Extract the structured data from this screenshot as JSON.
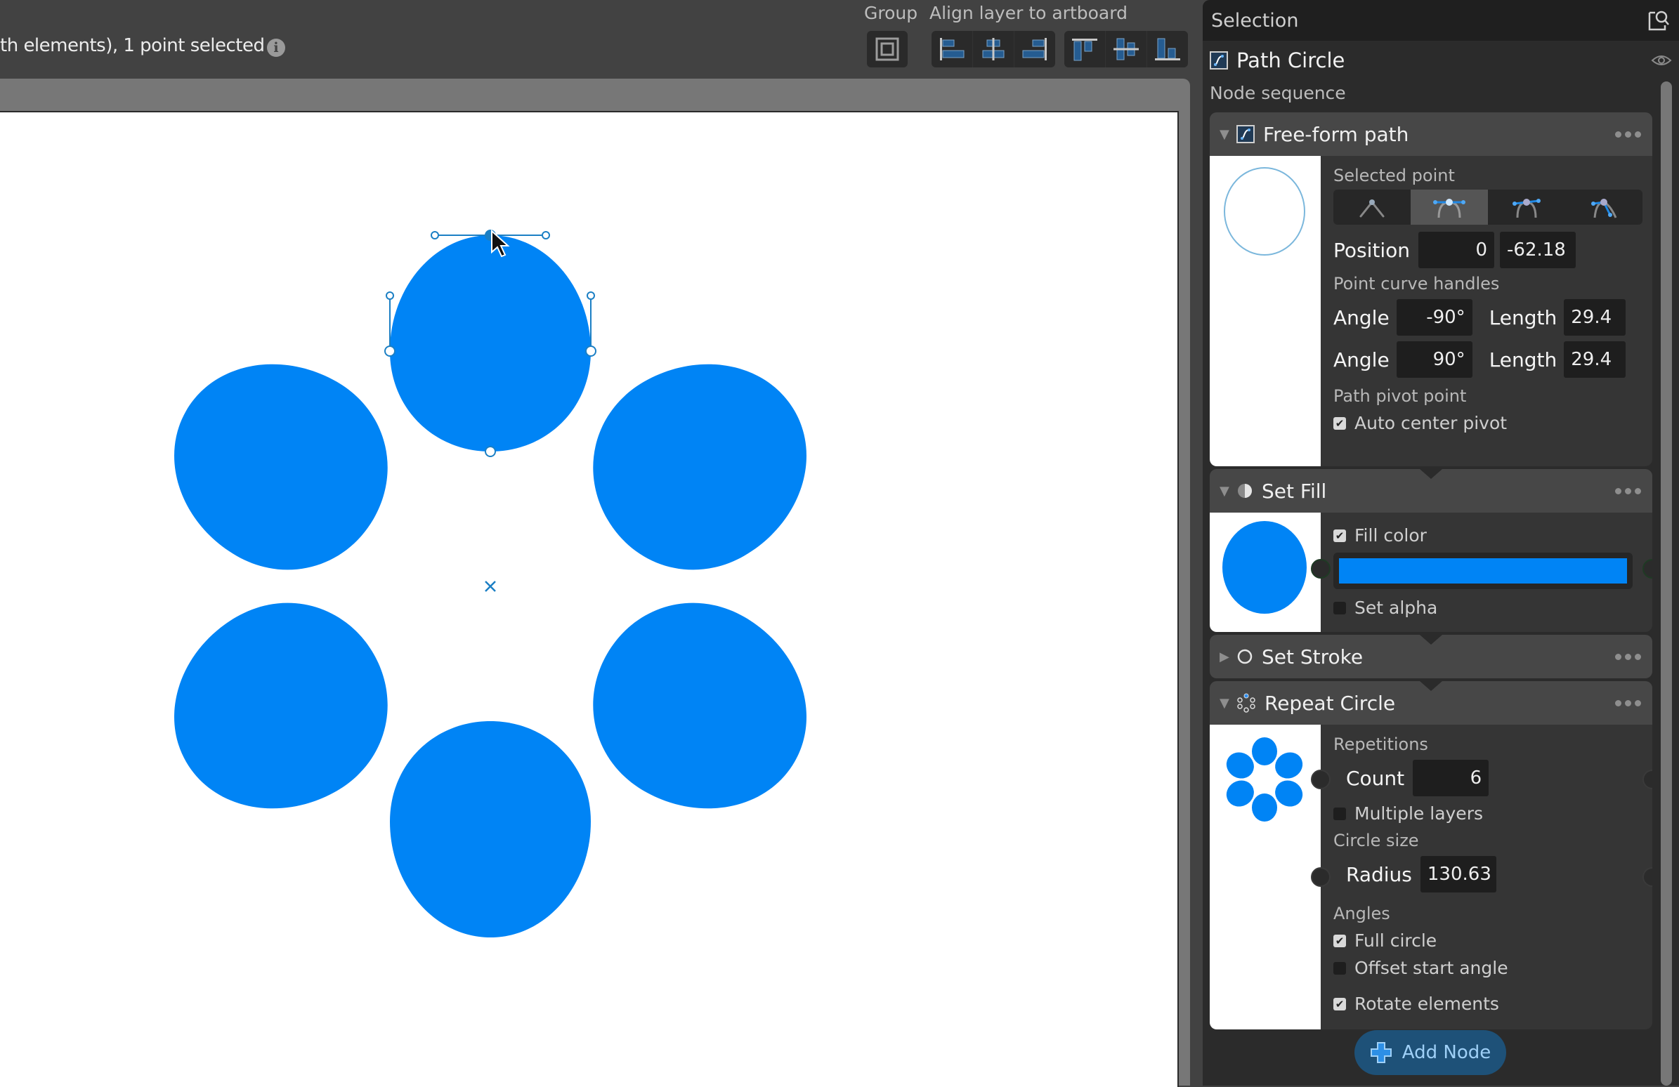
{
  "status": {
    "text": "th elements), 1 point selected",
    "info_icon": "info-icon"
  },
  "toolbar": {
    "group_label": "Group",
    "align_label": "Align layer to artboard",
    "group_button_icon": "group-frame-icon",
    "align_buttons": [
      {
        "name": "align-left",
        "icon": "align-left-icon"
      },
      {
        "name": "align-center-horizontal",
        "icon": "align-center-h-icon"
      },
      {
        "name": "align-right",
        "icon": "align-right-icon"
      },
      {
        "name": "align-top",
        "icon": "align-top-icon"
      },
      {
        "name": "align-center-vertical",
        "icon": "align-center-v-icon"
      },
      {
        "name": "align-bottom",
        "icon": "align-bottom-icon"
      }
    ]
  },
  "canvas": {
    "fill_color": "#0084f5",
    "repeat_count": 6,
    "selected_element": "top"
  },
  "panel": {
    "title": "Selection",
    "layer_name": "Path Circle",
    "node_sequence_label": "Node sequence",
    "nodes": {
      "freeform": {
        "title": "Free-form path",
        "selected_point_label": "Selected point",
        "point_types": [
          "corner",
          "smooth-symmetric",
          "smooth",
          "asymmetric"
        ],
        "active_point_type": 1,
        "position_label": "Position",
        "position_x": "0",
        "position_y": "-62.18",
        "handles_label": "Point curve handles",
        "angle_label": "Angle",
        "length_label": "Length",
        "handle1_angle": "-90°",
        "handle1_length": "29.4",
        "handle2_angle": "90°",
        "handle2_length": "29.4",
        "pivot_label": "Path pivot point",
        "auto_center_label": "Auto center pivot",
        "auto_center_checked": true
      },
      "fill": {
        "title": "Set Fill",
        "fill_color_label": "Fill color",
        "fill_color_checked": true,
        "color": "#0084f5",
        "set_alpha_label": "Set alpha",
        "set_alpha_checked": false
      },
      "stroke": {
        "title": "Set Stroke",
        "collapsed": true
      },
      "repeat": {
        "title": "Repeat Circle",
        "repetitions_label": "Repetitions",
        "count_label": "Count",
        "count": "6",
        "multiple_layers_label": "Multiple layers",
        "multiple_layers_checked": false,
        "circle_size_label": "Circle size",
        "radius_label": "Radius",
        "radius": "130.63",
        "angles_label": "Angles",
        "full_circle_label": "Full circle",
        "full_circle_checked": true,
        "offset_label": "Offset start angle",
        "offset_checked": false,
        "rotate_label": "Rotate elements",
        "rotate_checked": true
      }
    },
    "add_node_label": "Add Node"
  }
}
